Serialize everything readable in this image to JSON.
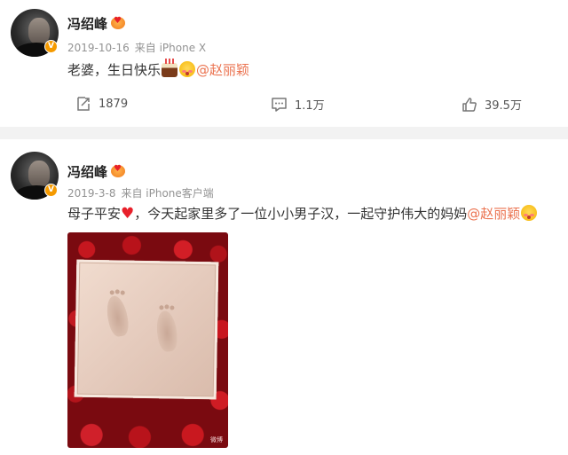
{
  "posts": [
    {
      "username": "冯绍峰",
      "verified_badge": "V",
      "vip_icon": "heart-emoji-icon",
      "date": "2019-10-16",
      "source": "来自 iPhone X",
      "text_before": "老婆，生日快乐",
      "mention": "@赵丽颖",
      "actions": {
        "repost": "1879",
        "comment": "1.1万",
        "like": "39.5万"
      }
    },
    {
      "username": "冯绍峰",
      "verified_badge": "V",
      "vip_icon": "heart-emoji-icon",
      "date": "2019-3-8",
      "source": "来自 iPhone客户端",
      "text_a": "母子平安",
      "text_b": "，今天起家里多了一位小小男子汉，一起守护伟大的妈妈",
      "mention": "@赵丽颖",
      "photo_watermark": "微博"
    }
  ],
  "colors": {
    "mention": "#eb7350",
    "verified": "#f59a00",
    "meta": "#939393"
  }
}
